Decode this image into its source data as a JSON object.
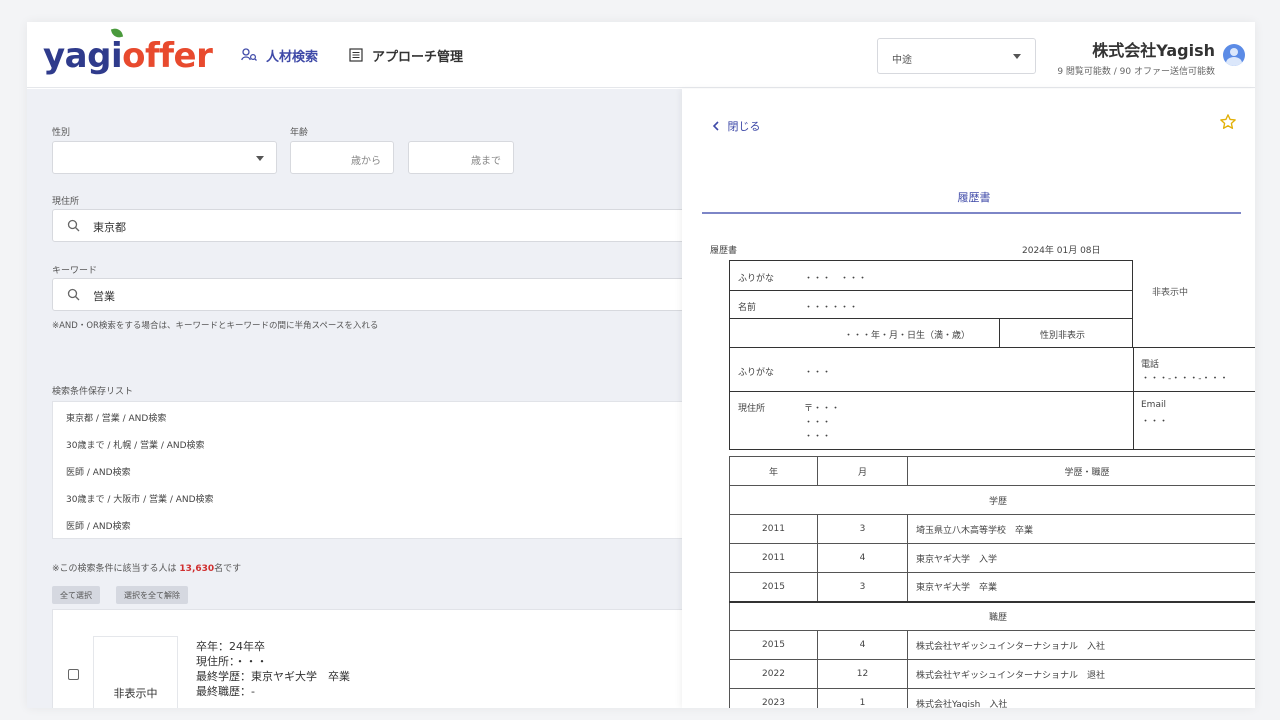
{
  "header": {
    "logo_part1": "yagi",
    "logo_part2": "offer",
    "nav": [
      {
        "label": "人材検索"
      },
      {
        "label": "アプローチ管理"
      }
    ],
    "type_select": "中途",
    "company": "株式会社Yagish",
    "quota": "9 閲覧可能数 / 90 オファー送信可能数"
  },
  "filters": {
    "gender_label": "性別",
    "gender_value": "",
    "age_label": "年齢",
    "age_from_placeholder": "歳から",
    "age_to_placeholder": "歳まで",
    "location_label": "現住所",
    "location_value": "東京都",
    "keyword_label": "キーワード",
    "keyword_value": "営業",
    "keyword_note": "※AND・OR検索をする場合は、キーワードとキーワードの間に半角スペースを入れる"
  },
  "saved": {
    "label": "検索条件保存リスト",
    "items": [
      "東京都 / 営業 / AND検索",
      "30歳まで / 札幌 / 営業 / AND検索",
      "医師 / AND検索",
      "30歳まで / 大阪市 / 営業 / AND検索",
      "医師 / AND検索"
    ]
  },
  "results": {
    "count_prefix": "※この検索条件に該当する人は",
    "count": "13,630",
    "count_suffix": "名です",
    "select_all": "全て選択",
    "clear_all": "選択を全て解除",
    "card": {
      "photo": "非表示中",
      "line1": "卒年：24年卒",
      "line2": "現住所：・・・",
      "line3": "最終学歴：東京ヤギ大学　卒業",
      "line4": "最終職歴：-"
    }
  },
  "resume": {
    "close": "閉じる",
    "tab": "履歴書",
    "doc_title": "履歴書",
    "date": "2024年 01月 08日",
    "photo_hidden": "非表示中",
    "furigana_label": "ふりがな",
    "furigana_value": "・・・　・・・",
    "name_label": "名前",
    "name_value": "・・・・・・",
    "birth": "・・・年・月・日生（満・歳）",
    "gender": "性別非表示",
    "addr_furigana_label": "ふりがな",
    "addr_furigana_value": "・・・",
    "address_label": "現住所",
    "address_line1": "〒・・・",
    "address_line2": "・・・",
    "address_line3": "・・・",
    "phone_label": "電話",
    "phone_value": "・・・-・・・-・・・",
    "email_label": "Email",
    "email_value": "・・・",
    "history_headers": {
      "year": "年",
      "month": "月",
      "desc": "学歴・職歴"
    },
    "education_heading": "学歴",
    "education": [
      {
        "year": "2011",
        "month": "3",
        "desc": "埼玉県立八木高等学校　卒業"
      },
      {
        "year": "2011",
        "month": "4",
        "desc": "東京ヤギ大学　入学"
      },
      {
        "year": "2015",
        "month": "3",
        "desc": "東京ヤギ大学　卒業"
      }
    ],
    "work_heading": "職歴",
    "work": [
      {
        "year": "2015",
        "month": "4",
        "desc": "株式会社ヤギッシュインターナショナル　入社"
      },
      {
        "year": "2022",
        "month": "12",
        "desc": "株式会社ヤギッシュインターナショナル　退社"
      },
      {
        "year": "2023",
        "month": "1",
        "desc": "株式会社Yagish　入社"
      }
    ]
  }
}
